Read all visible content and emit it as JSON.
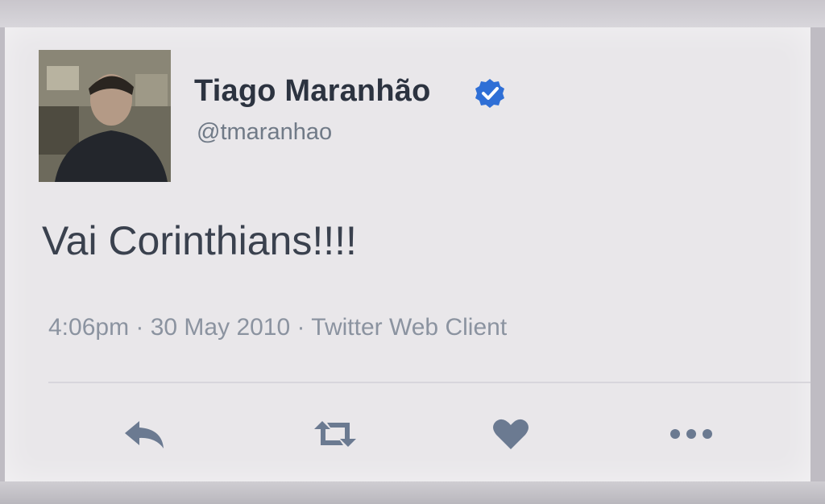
{
  "tweet": {
    "display_name": "Tiago Maranhão",
    "handle": "@tmaranhao",
    "text": "Vai Corinthians!!!!",
    "meta": "4:06pm · 30 May 2010 · Twitter Web Client",
    "verified": true
  },
  "actions": [
    {
      "icon": "reply-icon"
    },
    {
      "icon": "retweet-icon"
    },
    {
      "icon": "heart-icon"
    },
    {
      "icon": "more-icon"
    }
  ],
  "colors": {
    "name": "#2c3340",
    "handle": "#707a87",
    "text": "#3a414e",
    "meta": "#8b93a0",
    "action_icon": "#6b7a91",
    "verified_blue": "#2f6fd6"
  }
}
